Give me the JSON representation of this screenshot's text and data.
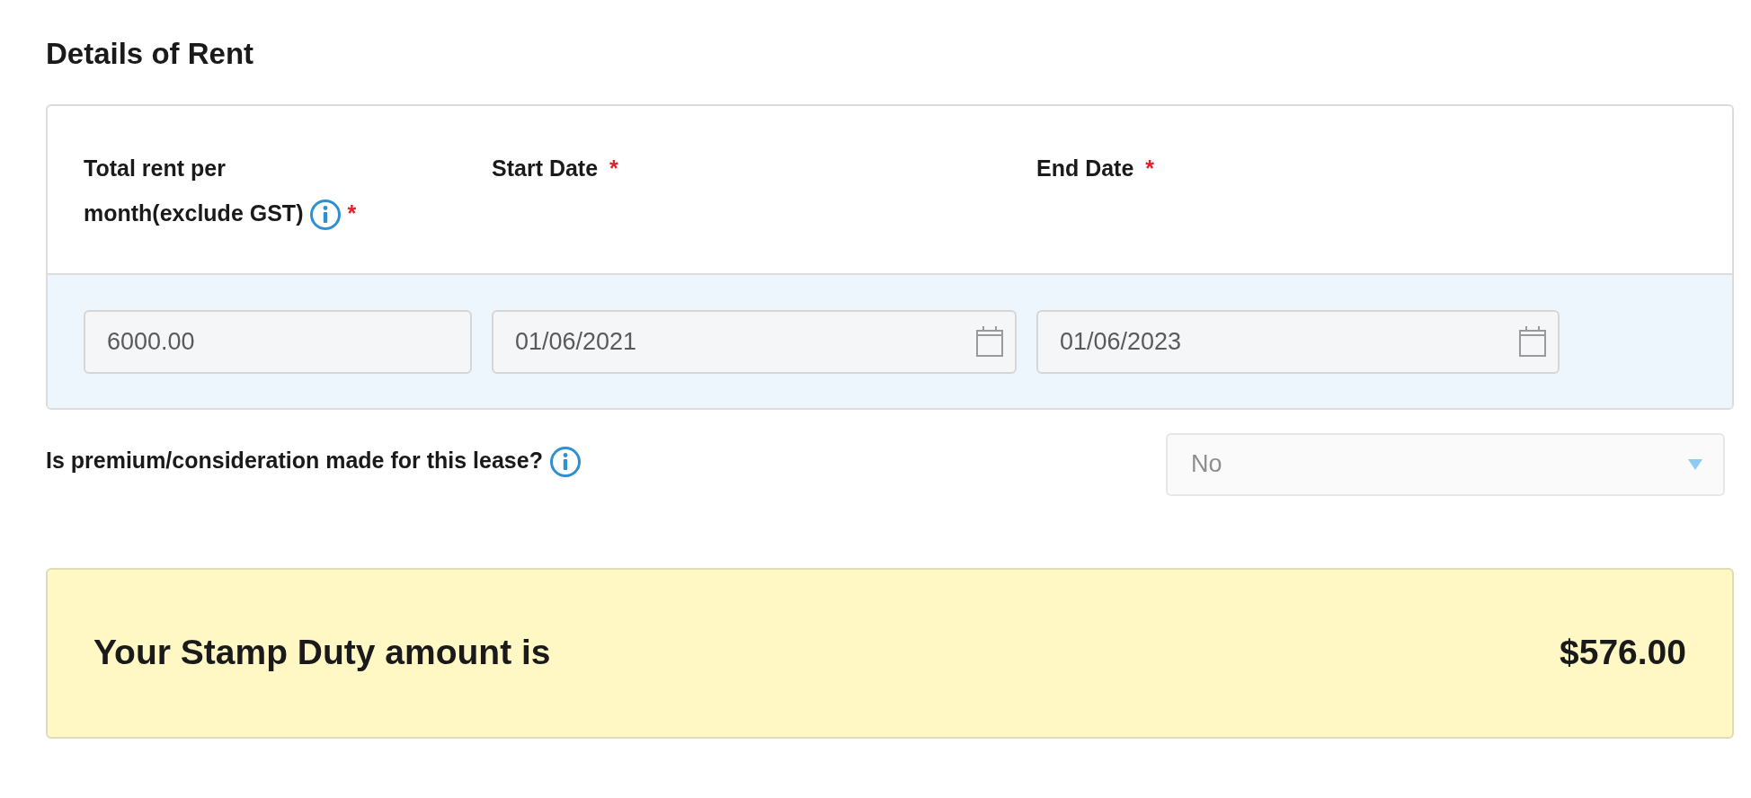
{
  "section_title": "Details of Rent",
  "rent_table": {
    "columns": [
      {
        "label": "Total rent per month(exclude GST)",
        "info": true,
        "required_mark": "*"
      },
      {
        "label": "Start Date",
        "info": false,
        "required_mark": "*"
      },
      {
        "label": "End Date",
        "info": false,
        "required_mark": "*"
      }
    ],
    "fields": [
      {
        "kind": "text",
        "value": "6000.00"
      },
      {
        "kind": "date",
        "value": "01/06/2021"
      },
      {
        "kind": "date",
        "value": "01/06/2023"
      }
    ]
  },
  "premium": {
    "question": "Is premium/consideration made for this lease?",
    "info": true,
    "value": "No"
  },
  "result": {
    "label": "Your Stamp Duty amount is",
    "amount": "$576.00"
  }
}
